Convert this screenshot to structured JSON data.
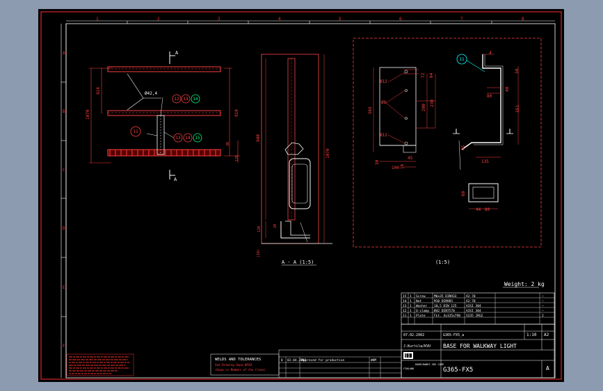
{
  "drawing": {
    "border_letters": [
      "A",
      "B",
      "C",
      "D",
      "E",
      "F"
    ],
    "border_numbers": [
      "1",
      "2",
      "3",
      "4",
      "5",
      "6",
      "7",
      "8"
    ],
    "views": {
      "top": {
        "section_marker": "A",
        "dims": {
          "d_left": "1070",
          "d_left2": "914",
          "d_right": "910",
          "d_bottom1": "30",
          "d_bottom2": "120",
          "dia": "Ø42,4"
        },
        "balloons": [
          "12",
          "13",
          "14",
          "11",
          "13",
          "14",
          "15"
        ]
      },
      "section": {
        "label": "A - A (1:5)",
        "dims": {
          "height": "1070",
          "inner": "940",
          "base_small": "120",
          "bottom_offset": "(10)",
          "foot_a": "20"
        }
      },
      "detail": {
        "label": "(1:5)",
        "balloon": "11",
        "dims": {
          "d4": "4",
          "d34": "34",
          "d80": "80",
          "d40": "40",
          "d351": "351",
          "d135": "135",
          "d565": "565",
          "d200": "200",
          "d230": "230",
          "d64": "64",
          "d72": "72",
          "d12a": "Ø12",
          "d8": "Ø8",
          "d12b": "Ø12",
          "d30": "30",
          "d100": "100",
          "d45": "45",
          "d60": "60",
          "d44": "44",
          "d80b": "80",
          "d16": "16"
        }
      }
    },
    "weight": "Weight: 2 kg",
    "bom_rows": [
      {
        "item": "15",
        "qty": "1",
        "name": "Screw",
        "spec": "M6x35 DIN933",
        "mat": "A2-70",
        "extra": "—"
      },
      {
        "item": "14",
        "qty": "1",
        "name": "Nut",
        "spec": "M10 DIN985",
        "mat": "A2-70",
        "extra": "—"
      },
      {
        "item": "13",
        "qty": "1",
        "name": "Washer",
        "spec": "10,5 DIN 125",
        "mat": "AISI 304",
        "extra": "—"
      },
      {
        "item": "12",
        "qty": "1",
        "name": "U-clamp",
        "spec": "Ø42 DIN7570",
        "mat": "AISI 304",
        "extra": "—"
      },
      {
        "item": "11",
        "qty": "1",
        "name": "Plate",
        "spec": "FLt. 4x135x790",
        "mat": "S235 JRG2",
        "extra": "2"
      }
    ],
    "title_block": {
      "date": "07.02.2002",
      "file": "G365-FX5_a",
      "scale": "1:10",
      "size": "A2",
      "drawn_by": "J.Kurtila/KVU",
      "title": "BASE FOR WALKWAY LIGHT",
      "company": "KONECRANES VKE CORP",
      "country": "FINLAND",
      "drawing_no": "G365-FX5",
      "rev": "A"
    },
    "revision": {
      "rev": "0",
      "date": "02.04.2003",
      "text": "Approved for production",
      "by": "WKM"
    },
    "welds": {
      "title": "WELDS AND TOLERANCES",
      "line1": "See Drawing    Gepa-0P20",
      "line2": "(Gepa is Member of the Crane)"
    },
    "colors": {
      "sheet": "#000000",
      "background": "#8c9bb0",
      "border": "#ff3030",
      "frame": "#ffffff",
      "dim": "#ff4040",
      "part": "#e0e0e0",
      "accent": "#00ff00"
    }
  }
}
